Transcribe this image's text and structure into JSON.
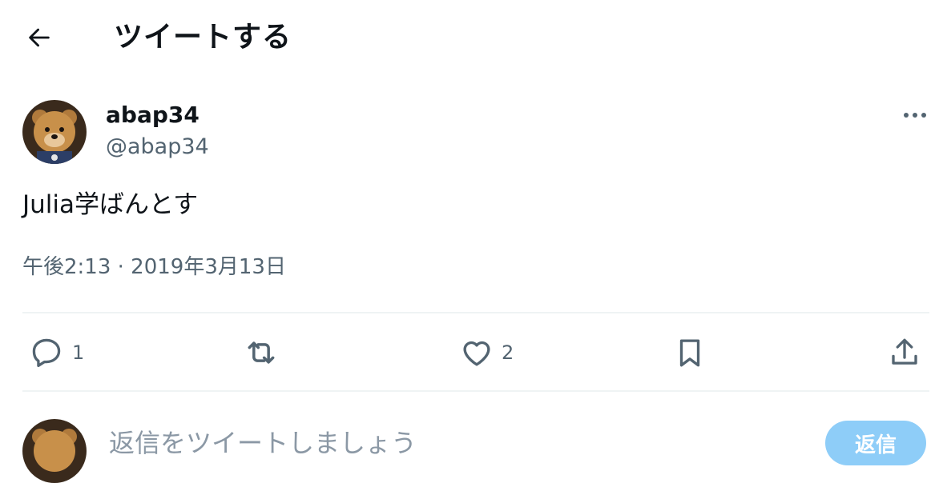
{
  "header": {
    "title": "ツイートする",
    "back_icon": "arrow-left-icon"
  },
  "tweet": {
    "display_name": "abap34",
    "handle": "@abap34",
    "text": "Julia学ばんとす",
    "timestamp": "午後2:13 · 2019年3月13日",
    "more_icon": "more-horizontal-icon"
  },
  "actions": {
    "reply_count": "1",
    "retweet_count": "",
    "like_count": "2",
    "icons": [
      "reply-icon",
      "retweet-icon",
      "like-icon",
      "bookmark-icon",
      "share-icon"
    ]
  },
  "compose": {
    "placeholder": "返信をツイートしましょう",
    "reply_button_label": "返信"
  },
  "colors": {
    "text_primary": "#0f1419",
    "text_secondary": "#536471",
    "divider": "#eff3f4",
    "reply_button": "#8ecdf8"
  }
}
